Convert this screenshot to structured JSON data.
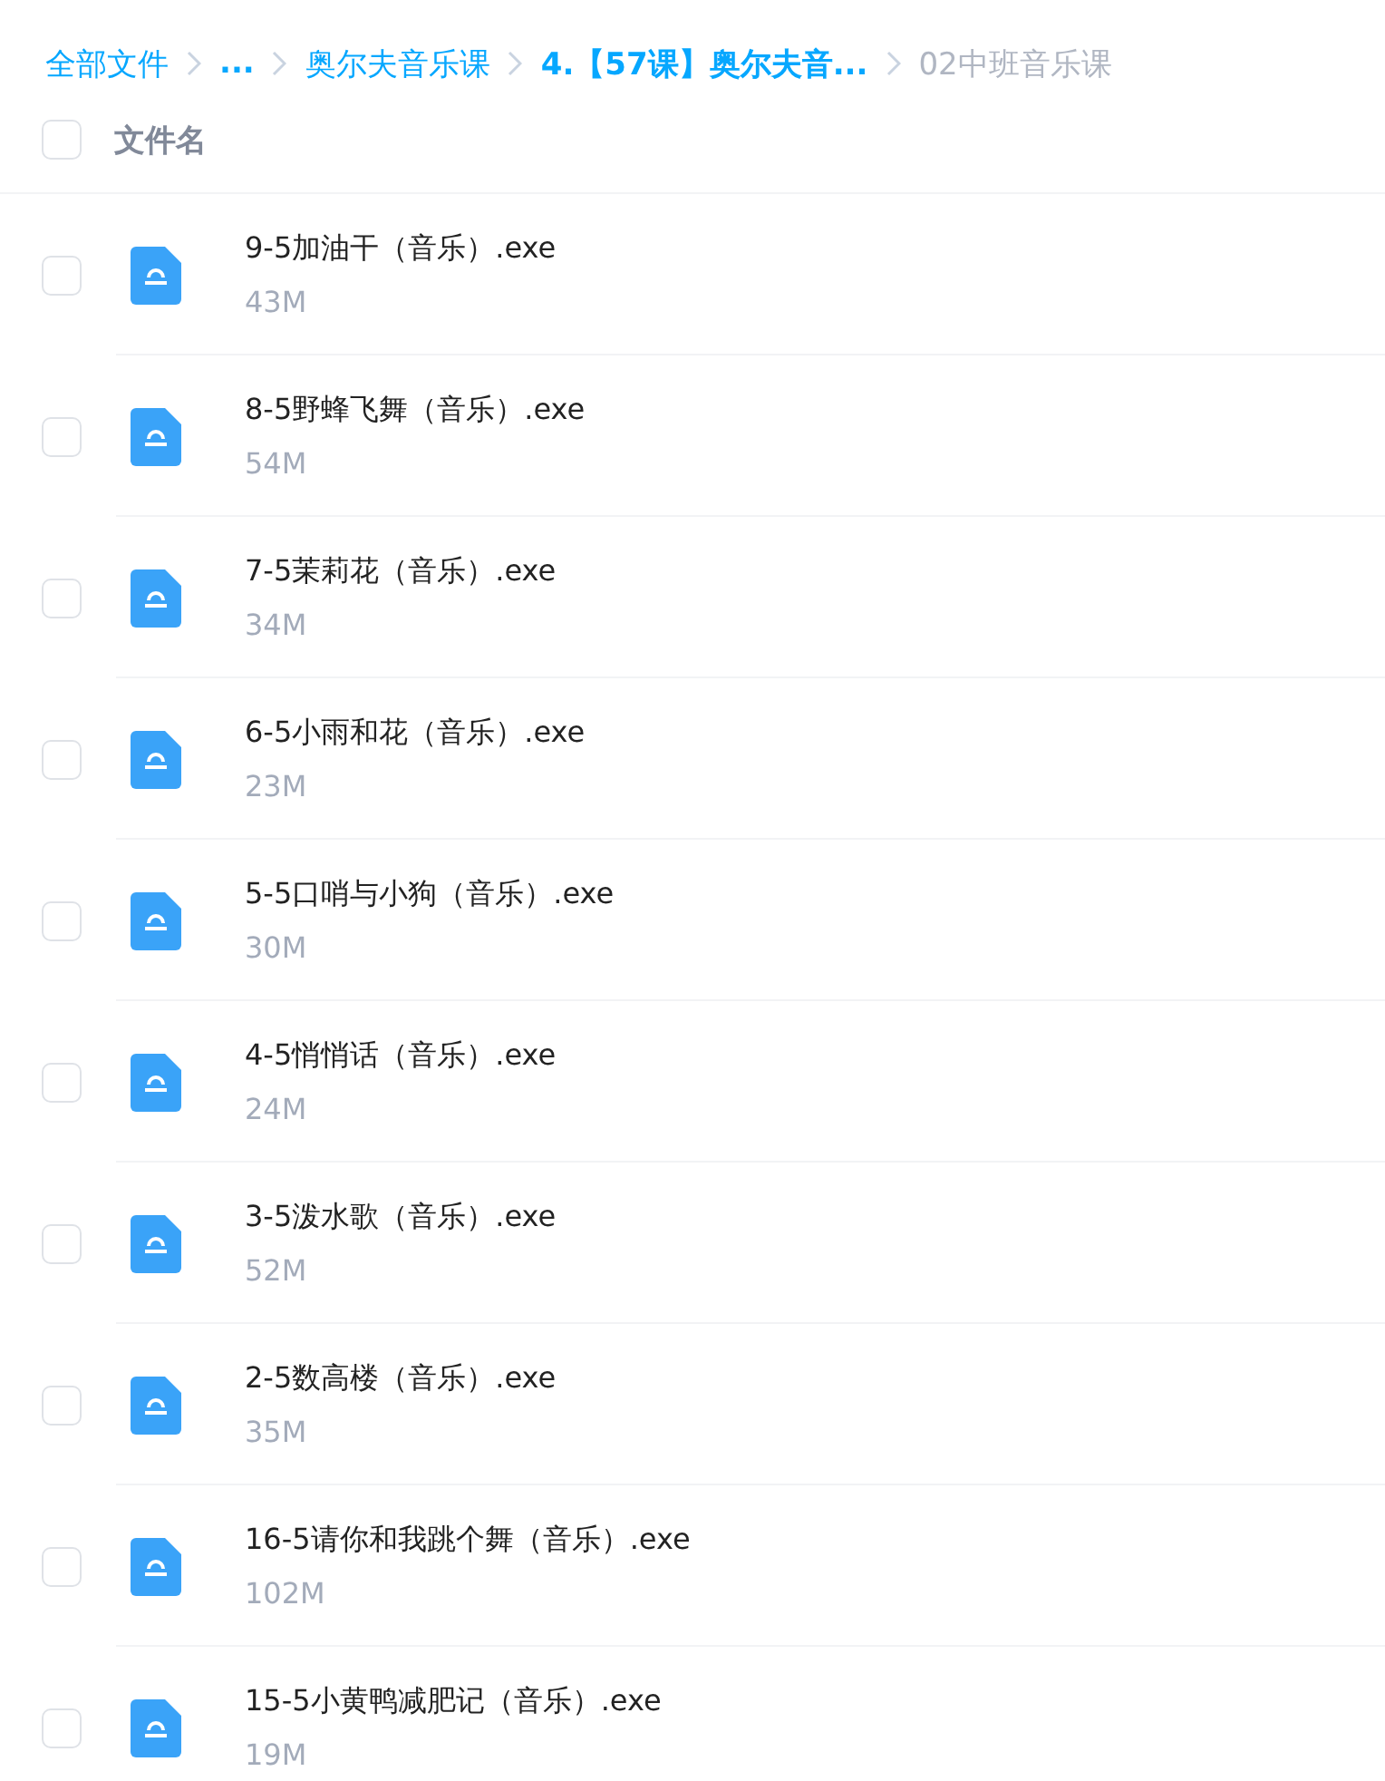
{
  "breadcrumb": [
    {
      "label": "全部文件",
      "selected": false,
      "emphasized": false
    },
    {
      "label": "...",
      "selected": false,
      "emphasized": true
    },
    {
      "label": "奥尔夫音乐课",
      "selected": false,
      "emphasized": false
    },
    {
      "label": "4.【57课】奥尔夫音...",
      "selected": false,
      "emphasized": true
    },
    {
      "label": "02中班音乐课",
      "selected": true,
      "emphasized": false
    }
  ],
  "header": {
    "label": "文件名",
    "checked": false
  },
  "files": [
    {
      "name": "9-5加油干（音乐）.exe",
      "size": "43M",
      "checked": false
    },
    {
      "name": "8-5野蜂飞舞（音乐）.exe",
      "size": "54M",
      "checked": false
    },
    {
      "name": "7-5茉莉花（音乐）.exe",
      "size": "34M",
      "checked": false
    },
    {
      "name": "6-5小雨和花（音乐）.exe",
      "size": "23M",
      "checked": false
    },
    {
      "name": "5-5口哨与小狗（音乐）.exe",
      "size": "30M",
      "checked": false
    },
    {
      "name": "4-5悄悄话（音乐）.exe",
      "size": "24M",
      "checked": false
    },
    {
      "name": "3-5泼水歌（音乐）.exe",
      "size": "52M",
      "checked": false
    },
    {
      "name": "2-5数高楼（音乐）.exe",
      "size": "35M",
      "checked": false
    },
    {
      "name": "16-5请你和我跳个舞（音乐）.exe",
      "size": "102M",
      "checked": false
    },
    {
      "name": "15-5小黄鸭减肥记（音乐）.exe",
      "size": "19M",
      "checked": false
    }
  ]
}
